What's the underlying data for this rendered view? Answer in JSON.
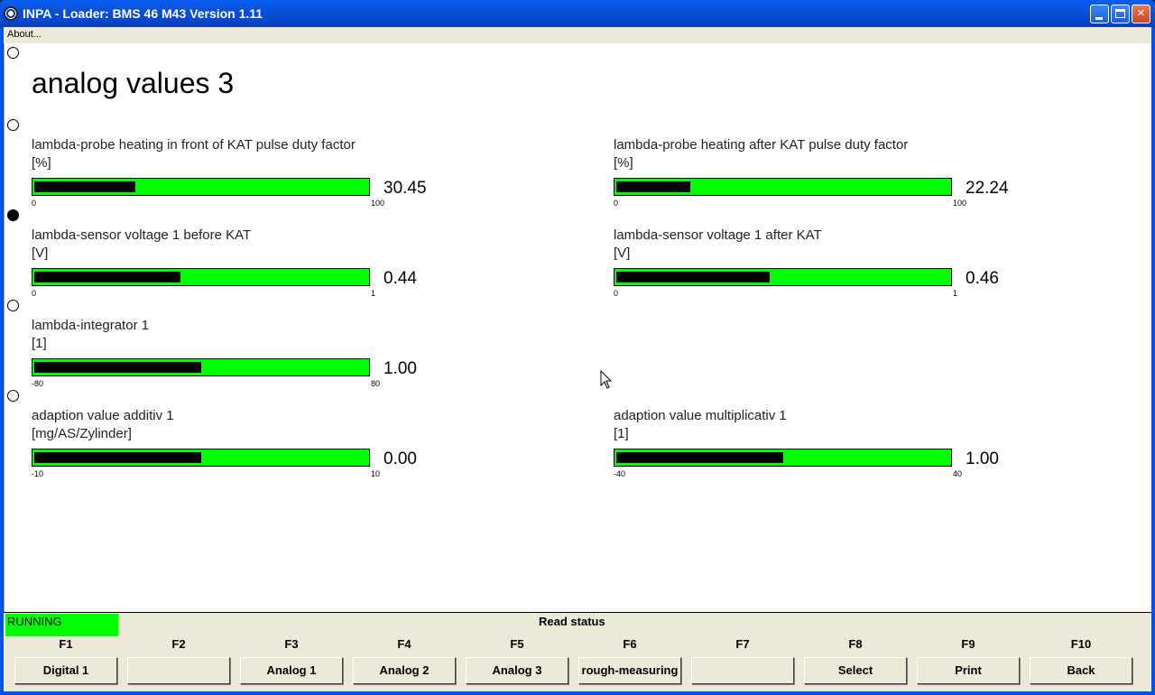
{
  "window": {
    "title": "INPA - Loader:  BMS 46 M43 Version 1.11"
  },
  "menu": {
    "about": "About..."
  },
  "page": {
    "title": "analog values 3"
  },
  "gauges": [
    {
      "label": "lambda-probe heating in front of KAT pulse duty factor",
      "unit": "[%]",
      "value": "30.45",
      "min": "0",
      "max": "100",
      "fraction": 0.3045
    },
    {
      "label": "lambda-probe heating after KAT pulse duty factor",
      "unit": "[%]",
      "value": "22.24",
      "min": "0",
      "max": "100",
      "fraction": 0.2224
    },
    {
      "label": "lambda-sensor voltage 1 before KAT",
      "unit": "[V]",
      "value": "0.44",
      "min": "0",
      "max": "1",
      "fraction": 0.44
    },
    {
      "label": "lambda-sensor voltage 1 after KAT",
      "unit": "[V]",
      "value": "0.46",
      "min": "0",
      "max": "1",
      "fraction": 0.46
    },
    {
      "label": "lambda-integrator 1",
      "unit": "[1]",
      "value": "1.00",
      "min": "-80",
      "max": "80",
      "fraction": 0.5
    },
    {
      "label": "adaption value additiv 1",
      "unit": "[mg/AS/Zylinder]",
      "value": "0.00",
      "min": "-10",
      "max": "10",
      "fraction": 0.5
    },
    {
      "label": "adaption value multiplicativ 1",
      "unit": "[1]",
      "value": "1.00",
      "min": "-40",
      "max": "40",
      "fraction": 0.5
    }
  ],
  "status": {
    "state": "RUNNING",
    "message": "Read status",
    "state_color": "#00ff00"
  },
  "fkeys": [
    {
      "key": "F1",
      "label": "Digital 1"
    },
    {
      "key": "F2",
      "label": ""
    },
    {
      "key": "F3",
      "label": "Analog 1"
    },
    {
      "key": "F4",
      "label": "Analog 2"
    },
    {
      "key": "F5",
      "label": "Analog 3"
    },
    {
      "key": "F6",
      "label": "rough-measuring"
    },
    {
      "key": "F7",
      "label": ""
    },
    {
      "key": "F8",
      "label": "Select"
    },
    {
      "key": "F9",
      "label": "Print"
    },
    {
      "key": "F10",
      "label": "Back"
    }
  ],
  "colors": {
    "bar_background": "#00ff00",
    "bar_fill": "#000000"
  }
}
